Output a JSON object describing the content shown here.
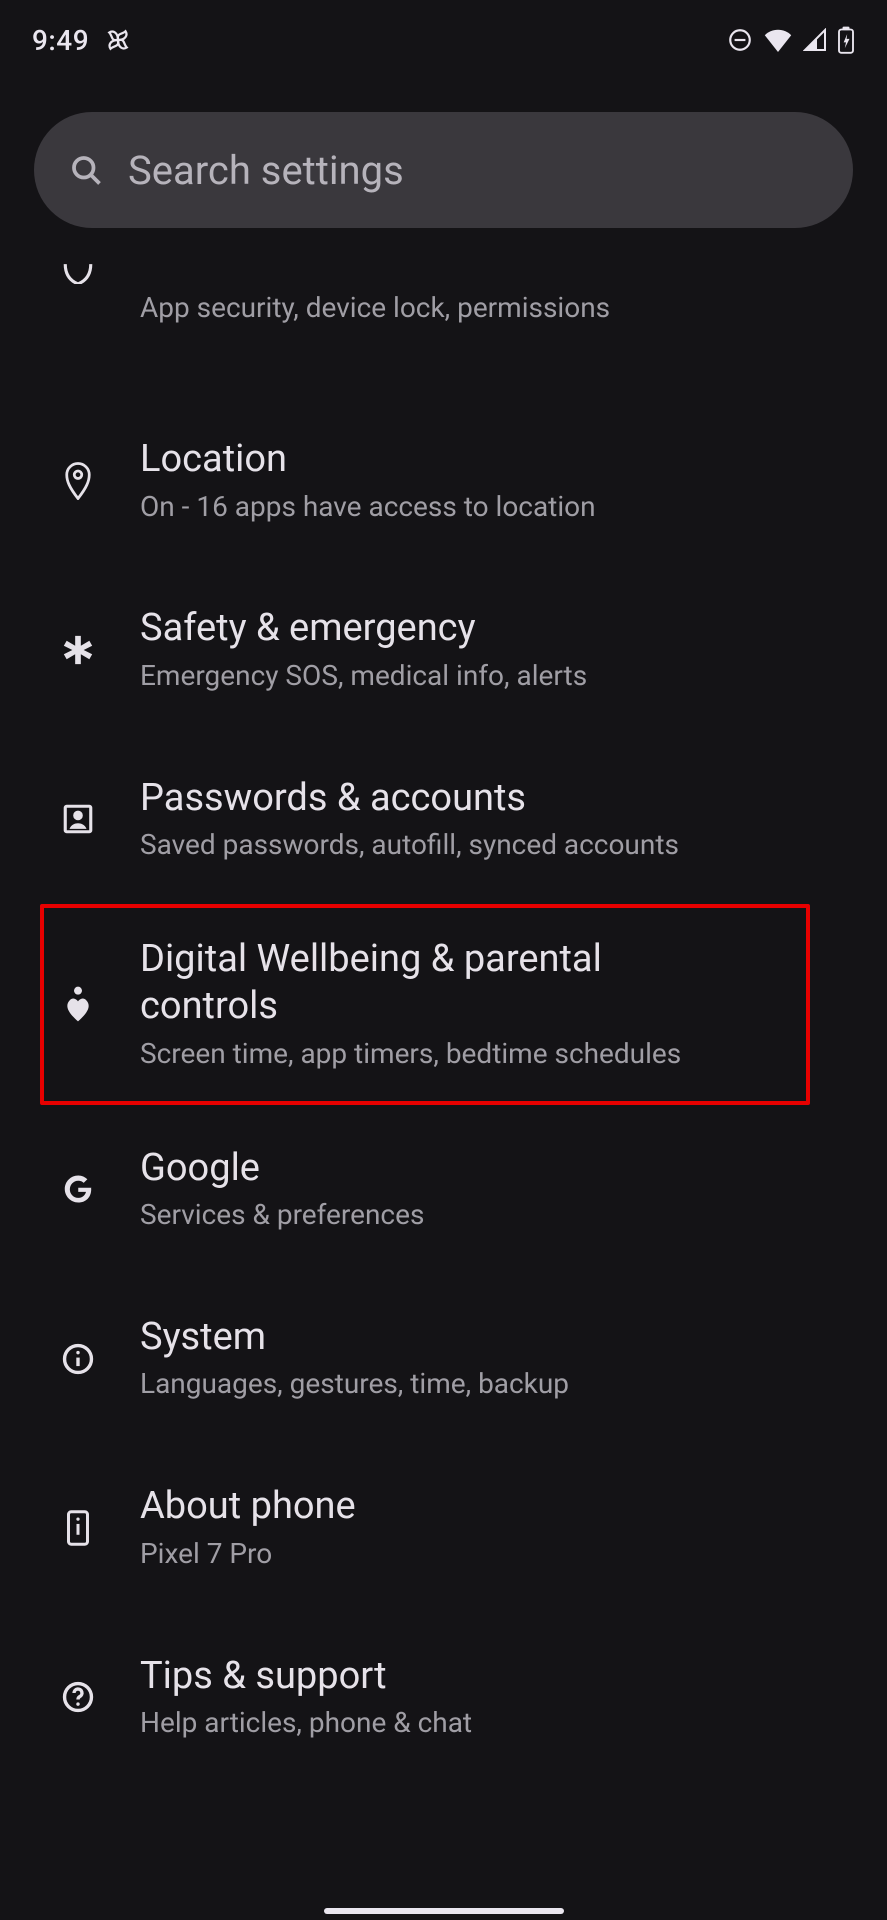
{
  "status": {
    "time": "9:49"
  },
  "search": {
    "placeholder": "Search settings"
  },
  "items": {
    "security": {
      "subtitle": "App security, device lock, permissions"
    },
    "location": {
      "title": "Location",
      "subtitle": "On - 16 apps have access to location"
    },
    "safety": {
      "title": "Safety & emergency",
      "subtitle": "Emergency SOS, medical info, alerts"
    },
    "passwords": {
      "title": "Passwords & accounts",
      "subtitle": "Saved passwords, autofill, synced accounts"
    },
    "wellbeing": {
      "title": "Digital Wellbeing & parental controls",
      "subtitle": "Screen time, app timers, bedtime schedules"
    },
    "google": {
      "title": "Google",
      "subtitle": "Services & preferences"
    },
    "system": {
      "title": "System",
      "subtitle": "Languages, gestures, time, backup"
    },
    "about": {
      "title": "About phone",
      "subtitle": "Pixel 7 Pro"
    },
    "tips": {
      "title": "Tips & support",
      "subtitle": "Help articles, phone & chat"
    }
  },
  "highlight": "wellbeing"
}
